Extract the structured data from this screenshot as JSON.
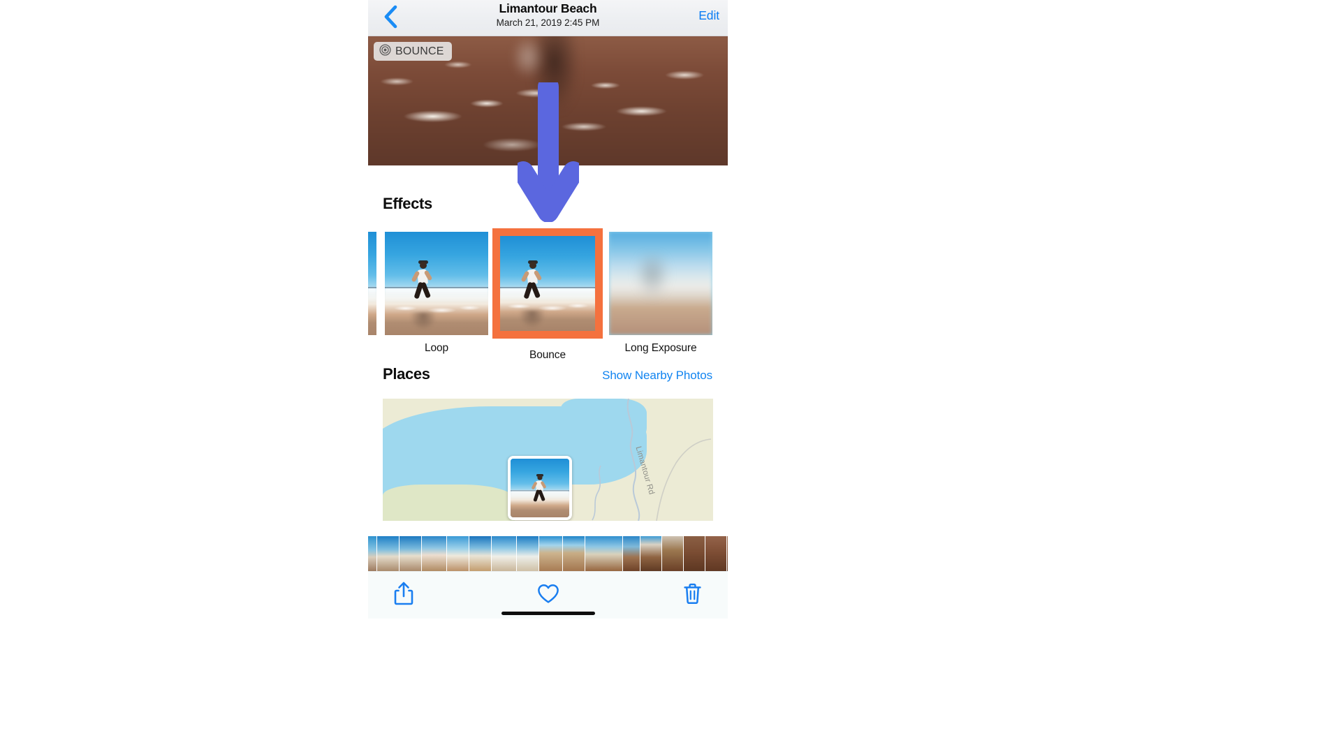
{
  "navbar": {
    "back_icon": "chevron-left-icon",
    "title": "Limantour Beach",
    "subtitle": "March 21, 2019  2:45 PM",
    "edit_label": "Edit"
  },
  "hero": {
    "badge_icon": "live-photo-bounce-icon",
    "badge_label": "BOUNCE"
  },
  "effects": {
    "heading": "Effects",
    "selected": "Bounce",
    "selection_color": "#f4713e",
    "items": [
      {
        "label": "",
        "name": "effect-live-partial"
      },
      {
        "label": "Loop",
        "name": "effect-loop"
      },
      {
        "label": "Bounce",
        "name": "effect-bounce"
      },
      {
        "label": "Long Exposure",
        "name": "effect-long-exposure"
      }
    ]
  },
  "places": {
    "heading": "Places",
    "link_label": "Show Nearby Photos",
    "link_color": "#1184f0",
    "map": {
      "road_label": "Limantour Rd",
      "land_color": "#ecebd5",
      "water_color": "#9ed8ee"
    }
  },
  "toolbar": {
    "share_icon": "share-upload-icon",
    "favorite_icon": "heart-icon",
    "delete_icon": "trash-icon",
    "icon_color": "#1a7ef0"
  },
  "annotation": {
    "arrow_icon": "down-arrow-annotation",
    "arrow_color": "#5b67df"
  }
}
